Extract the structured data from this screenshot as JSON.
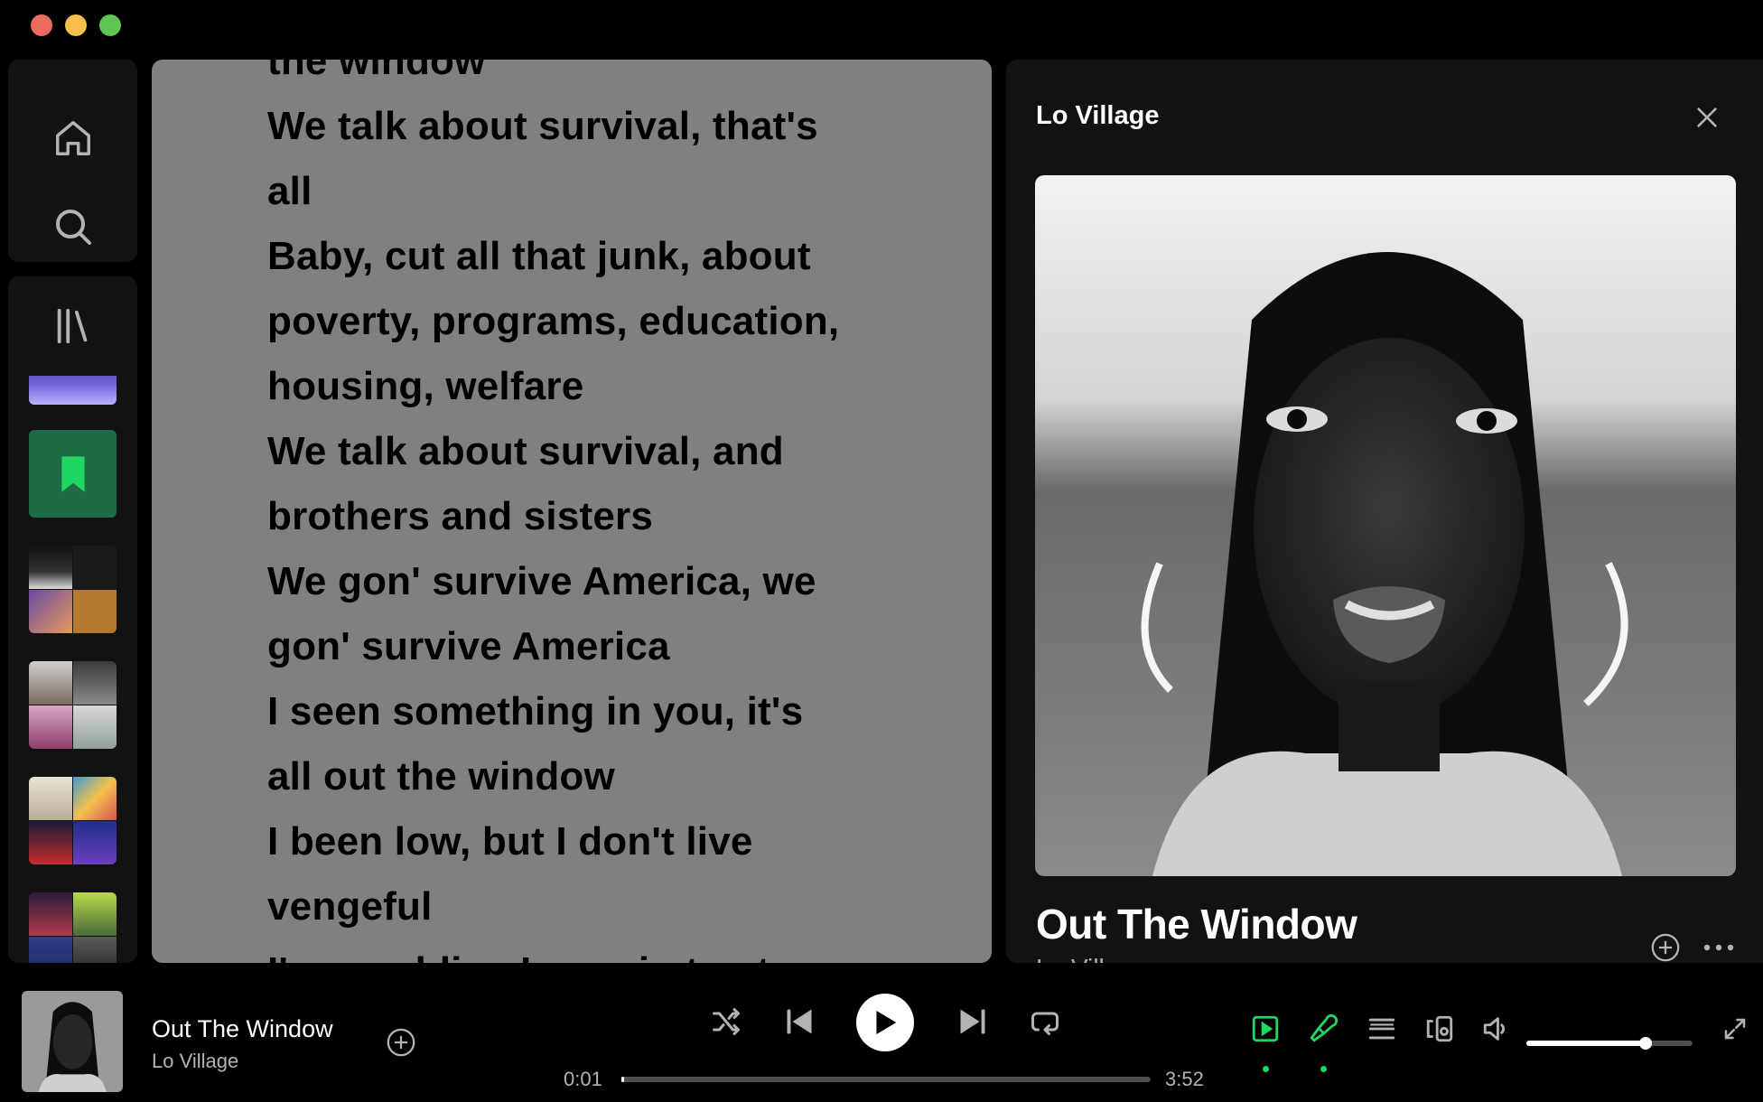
{
  "lyrics": {
    "lines": [
      "the window",
      "We talk about survival, that's",
      "all",
      "Baby, cut all that junk, about",
      "poverty, programs, education,",
      "housing, welfare",
      "We talk about survival, and",
      "brothers and sisters",
      "We gon' survive America, we",
      "gon' survive America",
      "I seen something in you, it's",
      "all out the window",
      "I been low, but I don't live",
      "vengeful",
      "I'm a soldier, I remain tap toes"
    ]
  },
  "panel": {
    "title": "Lo Village",
    "track_title": "Out The Window",
    "track_artist": "Lo Vill"
  },
  "player": {
    "track_title": "Out The Window",
    "track_artist": "Lo Village",
    "elapsed": "0:01",
    "duration": "3:52",
    "progress_fraction": 0.005,
    "volume_fraction": 0.72
  },
  "colors": {
    "accent": "#1ed760",
    "lyrics_bg": "#808080",
    "panel_bg": "#121212",
    "liked_songs_bg": "#1e6b46"
  },
  "icons": {
    "home": "home-icon",
    "search": "search-icon",
    "library": "library-icon",
    "close": "close-icon",
    "add": "add-circle-icon",
    "more": "more-dots-icon",
    "shuffle": "shuffle-icon",
    "previous": "skip-back-icon",
    "play": "play-icon",
    "next": "skip-forward-icon",
    "repeat": "repeat-icon",
    "now_playing_view": "now-playing-view-icon",
    "lyrics": "microphone-icon",
    "queue": "queue-icon",
    "connect": "connect-device-icon",
    "volume": "volume-icon",
    "fullscreen": "fullscreen-icon"
  }
}
